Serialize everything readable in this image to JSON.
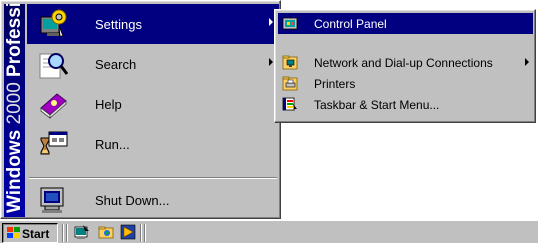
{
  "start_menu": {
    "banner": {
      "bold": "Windows",
      "light": "2000",
      "bold2": "Professional"
    },
    "items": [
      {
        "label": "Settings",
        "icon": "settings-icon",
        "has_submenu": true,
        "selected": true
      },
      {
        "label": "Search",
        "icon": "search-icon",
        "has_submenu": true,
        "selected": false
      },
      {
        "label": "Help",
        "icon": "help-icon",
        "has_submenu": false,
        "selected": false
      },
      {
        "label": "Run...",
        "icon": "run-icon",
        "has_submenu": false,
        "selected": false
      },
      {
        "label": "Shut Down...",
        "icon": "shut-down-icon",
        "has_submenu": false,
        "selected": false
      }
    ]
  },
  "settings_submenu": {
    "items": [
      {
        "label": "Control Panel",
        "icon": "control-panel-icon",
        "has_submenu": false,
        "selected": true
      },
      {
        "label": "Network and Dial-up Connections",
        "icon": "network-icon",
        "has_submenu": true,
        "selected": false
      },
      {
        "label": "Printers",
        "icon": "printers-icon",
        "has_submenu": false,
        "selected": false
      },
      {
        "label": "Taskbar & Start Menu...",
        "icon": "taskbar-icon",
        "has_submenu": false,
        "selected": false
      }
    ]
  },
  "taskbar": {
    "start_label": "Start",
    "quick_launch": [
      "show-desktop-icon",
      "explorer-icon",
      "media-player-icon"
    ]
  },
  "colors": {
    "selection": "#000080",
    "face": "#c0c0c0",
    "banner": "#000080"
  }
}
